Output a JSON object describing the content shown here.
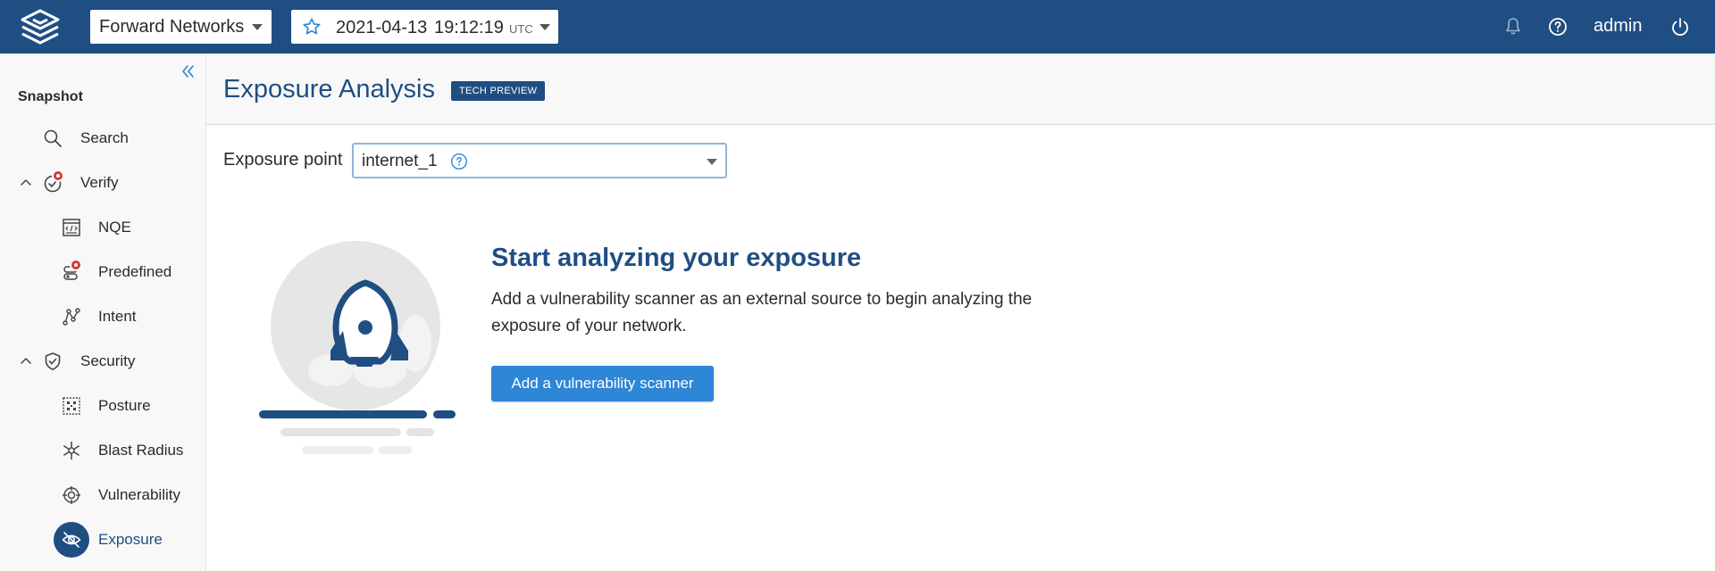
{
  "topbar": {
    "network_select": "Forward Networks",
    "snapshot": {
      "date": "2021-04-13",
      "time": "19:12:19",
      "timezone": "UTC"
    },
    "user": "admin",
    "icons": [
      "bell-icon",
      "help-icon",
      "power-icon"
    ]
  },
  "sidebar": {
    "heading": "Snapshot",
    "items": [
      {
        "label": "Search",
        "icon": "search-icon"
      },
      {
        "label": "Verify",
        "icon": "verify-icon",
        "expanded": true,
        "badge": true
      },
      {
        "label": "NQE",
        "icon": "nqe-icon"
      },
      {
        "label": "Predefined",
        "icon": "predefined-icon",
        "badge": true
      },
      {
        "label": "Intent",
        "icon": "intent-icon"
      },
      {
        "label": "Security",
        "icon": "shield-icon",
        "expanded": true
      },
      {
        "label": "Posture",
        "icon": "posture-icon"
      },
      {
        "label": "Blast Radius",
        "icon": "blast-radius-icon"
      },
      {
        "label": "Vulnerability",
        "icon": "vulnerability-icon"
      },
      {
        "label": "Exposure",
        "icon": "exposure-eye-icon",
        "active": true
      }
    ]
  },
  "main": {
    "title": "Exposure Analysis",
    "title_badge": "TECH PREVIEW",
    "exposure_point": {
      "label": "Exposure point",
      "value": "internet_1"
    },
    "empty_state": {
      "title": "Start analyzing your exposure",
      "text": "Add a vulnerability scanner as an external source to begin analyzing the exposure of your network.",
      "button": "Add a vulnerability scanner"
    }
  },
  "colors": {
    "brand": "#1f4e83",
    "button": "#2d86d6",
    "badge": "#d63b3b"
  }
}
